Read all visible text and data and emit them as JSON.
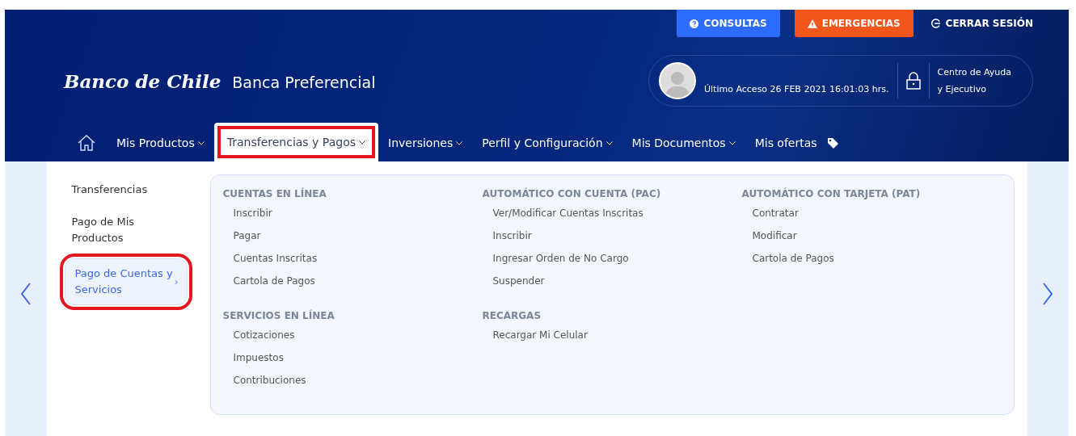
{
  "top_actions": [
    {
      "kind": "info",
      "label": "CONSULTAS"
    },
    {
      "kind": "alert",
      "label": "EMERGENCIAS"
    },
    {
      "kind": "logout",
      "label": "CERRAR SESIÓN"
    }
  ],
  "brand": {
    "logo": "Banco de Chile",
    "segment": "Banca Preferencial"
  },
  "user_panel": {
    "last_access": "Último Acceso 26 FEB 2021 16:01:03 hrs.",
    "help": [
      "Centro de Ayuda",
      "y Ejecutivo"
    ]
  },
  "nav": [
    {
      "label": "Mis Productos",
      "dropdown": true,
      "tag": false,
      "selected": false
    },
    {
      "label": "Transferencias y Pagos",
      "dropdown": true,
      "tag": false,
      "selected": true
    },
    {
      "label": "Inversiones",
      "dropdown": true,
      "tag": false,
      "selected": false
    },
    {
      "label": "Perfil y Configuración",
      "dropdown": true,
      "tag": false,
      "selected": false
    },
    {
      "label": "Mis Documentos",
      "dropdown": true,
      "tag": false,
      "selected": false
    },
    {
      "label": "Mis ofertas",
      "dropdown": false,
      "tag": true,
      "selected": false
    }
  ],
  "submenu": [
    {
      "label": "Transferencias",
      "selected": false
    },
    {
      "label": "Pago de Mis Productos",
      "selected": false
    },
    {
      "label": "Pago de Cuentas y Servicios",
      "selected": true
    }
  ],
  "sections": [
    {
      "title": "CUENTAS EN LÍNEA",
      "items": [
        "Inscribir",
        "Pagar",
        "Cuentas Inscritas",
        "Cartola de Pagos"
      ]
    },
    {
      "title": "AUTOMÁTICO CON CUENTA (PAC)",
      "items": [
        "Ver/Modificar Cuentas Inscritas",
        "Inscribir",
        "Ingresar Orden de No Cargo",
        "Suspender"
      ]
    },
    {
      "title": "AUTOMÁTICO CON TARJETA (PAT)",
      "items": [
        "Contratar",
        "Modificar",
        "Cartola de Pagos"
      ]
    },
    {
      "title": "SERVICIOS EN LÍNEA",
      "items": [
        "Cotizaciones",
        "Impuestos",
        "Contribuciones"
      ]
    },
    {
      "title": "RECARGAS",
      "items": [
        "Recargar Mi Celular"
      ]
    }
  ]
}
